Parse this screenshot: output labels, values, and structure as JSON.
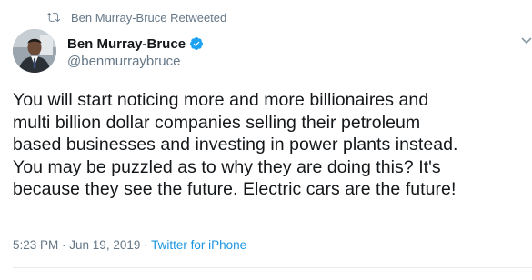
{
  "retweet_context": {
    "text": "Ben Murray-Bruce Retweeted",
    "icon": "retweet-icon"
  },
  "author": {
    "display_name": "Ben Murray-Bruce",
    "handle": "@benmurraybruce",
    "verified": true,
    "verified_icon": "verified-badge-icon",
    "avatar": "profile-photo"
  },
  "tweet": {
    "lines": [
      "You will start noticing more and more billionaires and",
      "multi billion dollar companies selling their petroleum",
      "based businesses and investing in power plants instead.",
      "You may be puzzled as to why they are doing this? It's",
      "because they see the future. Electric cars are the future!"
    ],
    "time": "5:23 PM",
    "separator": " · ",
    "date": "Jun 19, 2019",
    "source": "Twitter for iPhone"
  },
  "colors": {
    "text": "#14171a",
    "muted": "#657786",
    "accent": "#1b95e0",
    "verified": "#1da1f2"
  }
}
